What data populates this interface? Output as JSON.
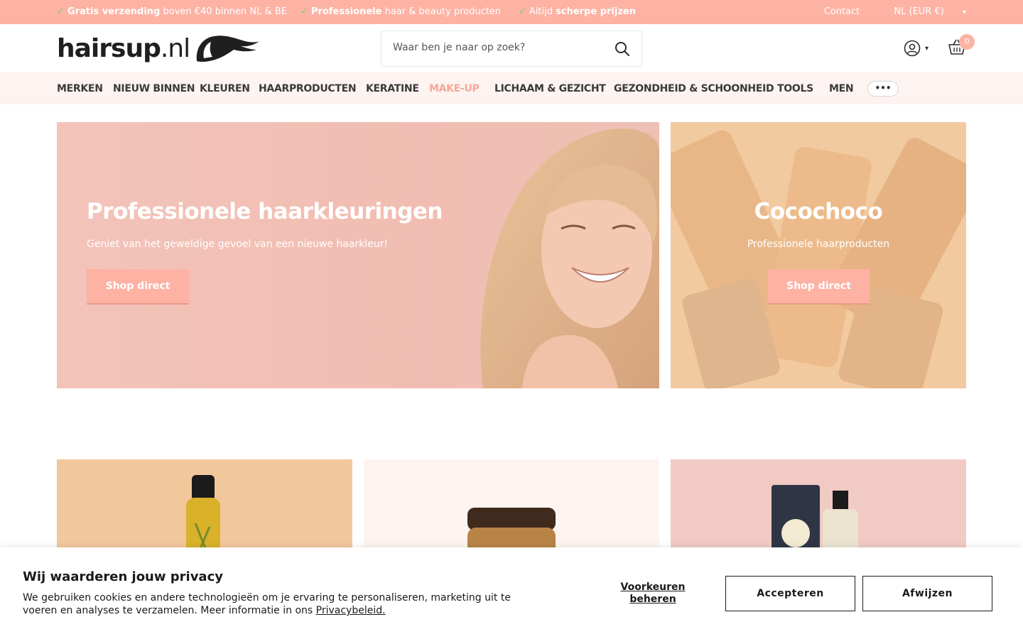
{
  "topbar": {
    "usp1": {
      "bold": "Gratis verzending",
      "rest": " boven €40 binnen NL & BE"
    },
    "usp2": {
      "bold": "Professionele",
      "rest": " haar & beauty producten"
    },
    "usp3": {
      "pre": "Altijd ",
      "bold": "scherpe prijzen"
    },
    "check": "✓",
    "contact": "Contact",
    "locale": "NL (EUR €)"
  },
  "header": {
    "logo_main": "hairsup",
    "logo_tld": ".nl",
    "search_placeholder": "Waar ben je naar op zoek?",
    "cart_count": "0"
  },
  "nav": {
    "items": [
      "MERKEN",
      "NIEUW BINNEN",
      "KLEUREN",
      "HAARPRODUCTEN",
      "KERATINE",
      "MAKE-UP",
      "LICHAAM & GEZICHT",
      "GEZONDHEID & SCHOONHEID",
      "TOOLS",
      "MEN"
    ],
    "more": "•••"
  },
  "banners": [
    {
      "title": "Professionele haarkleuringen",
      "subtitle": "Geniet van het geweldige gevoel van een nieuwe haarkleur!",
      "button": "Shop direct"
    },
    {
      "title": "Cocochoco",
      "subtitle": "Professionele haarproducten",
      "button": "Shop direct"
    }
  ],
  "cookie": {
    "title": "Wij waarderen jouw privacy",
    "text": "We gebruiken cookies en andere technologieën om je ervaring te personaliseren, marketing uit te voeren en analyses te verzamelen. Meer informatie in ons ",
    "link": "Privacybeleid.",
    "preferences": "Voorkeuren beheren",
    "accept": "Accepteren",
    "reject": "Afwijzen"
  },
  "colors": {
    "accent": "#fdb2a4",
    "nav_bg": "#fdf3f1",
    "active_nav": "#f6a79a",
    "check": "#6fcf87"
  }
}
